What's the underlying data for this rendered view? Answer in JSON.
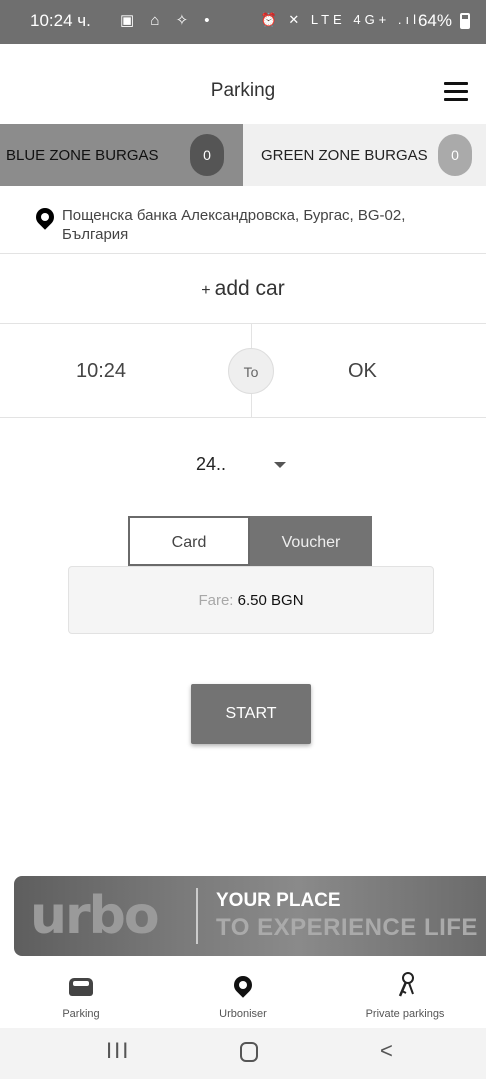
{
  "status_bar": {
    "time": "10:24 ч.",
    "left_icons": "▣ ⌂ ✧ •",
    "right_icons": "⏰ ✕ LTE 4G+ .ıl",
    "battery": "64%"
  },
  "header": {
    "title": "Parking"
  },
  "zones": [
    {
      "label": "BLUE ZONE BURGAS",
      "count": "0"
    },
    {
      "label": "GREEN ZONE BURGAS",
      "count": "0"
    }
  ],
  "location": {
    "address": "Пощенска банка Александровска, Бургас, BG-02, България"
  },
  "add_car": {
    "plus": "+",
    "label": "add car"
  },
  "time_range": {
    "start": "10:24",
    "to_label": "To",
    "end": "OK"
  },
  "duration": {
    "value": "24.."
  },
  "payment": {
    "card_label": "Card",
    "voucher_label": "Voucher",
    "fare_label": "Fare:",
    "fare_value": "6.50 BGN"
  },
  "start_button": {
    "label": "START"
  },
  "banner": {
    "logo": "urbo",
    "tagline_1": "YOUR PLACE",
    "tagline_2": "TO EXPERIENCE LIFE"
  },
  "bottom_nav": [
    {
      "label": "Parking",
      "icon": "car-icon"
    },
    {
      "label": "Urboniser",
      "icon": "pin-icon"
    },
    {
      "label": "Private parkings",
      "icon": "key-icon"
    }
  ],
  "system_nav": {
    "recents": "III",
    "back": "<"
  }
}
